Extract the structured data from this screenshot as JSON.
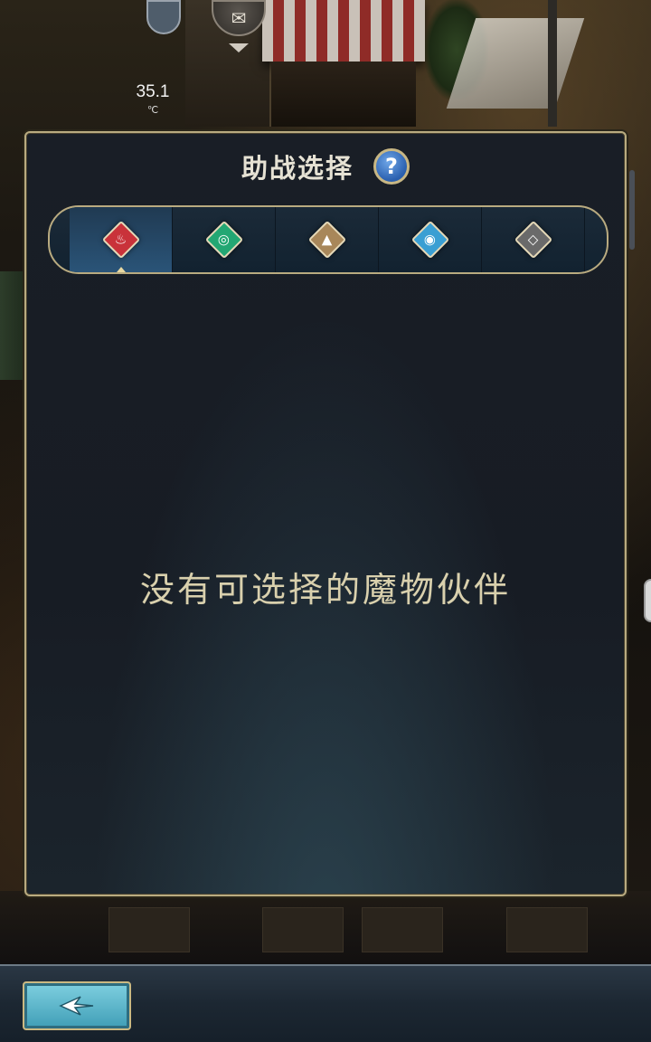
{
  "hud": {
    "temperature_value": "35.1",
    "temperature_unit": "℃"
  },
  "panel": {
    "title": "助战选择",
    "help_label": "?",
    "empty_message": "没有可选择的魔物伙伴",
    "element_tabs": [
      {
        "icon": "fire-element-icon",
        "color": "#c9323a",
        "glyph": "♨",
        "active": true
      },
      {
        "icon": "wind-element-icon",
        "color": "#23a773",
        "glyph": "◎",
        "active": false
      },
      {
        "icon": "earth-element-icon",
        "color": "#a8875a",
        "glyph": "▲",
        "active": false
      },
      {
        "icon": "water-element-icon",
        "color": "#3a9fd3",
        "glyph": "◉",
        "active": false
      },
      {
        "icon": "neutral-element-icon",
        "color": "#6a6a6a",
        "glyph": "◇",
        "active": false
      }
    ]
  },
  "colors": {
    "panel_border": "#b9ab80",
    "message_text": "#d9d0ad",
    "help_blue": "#2a5fae"
  }
}
